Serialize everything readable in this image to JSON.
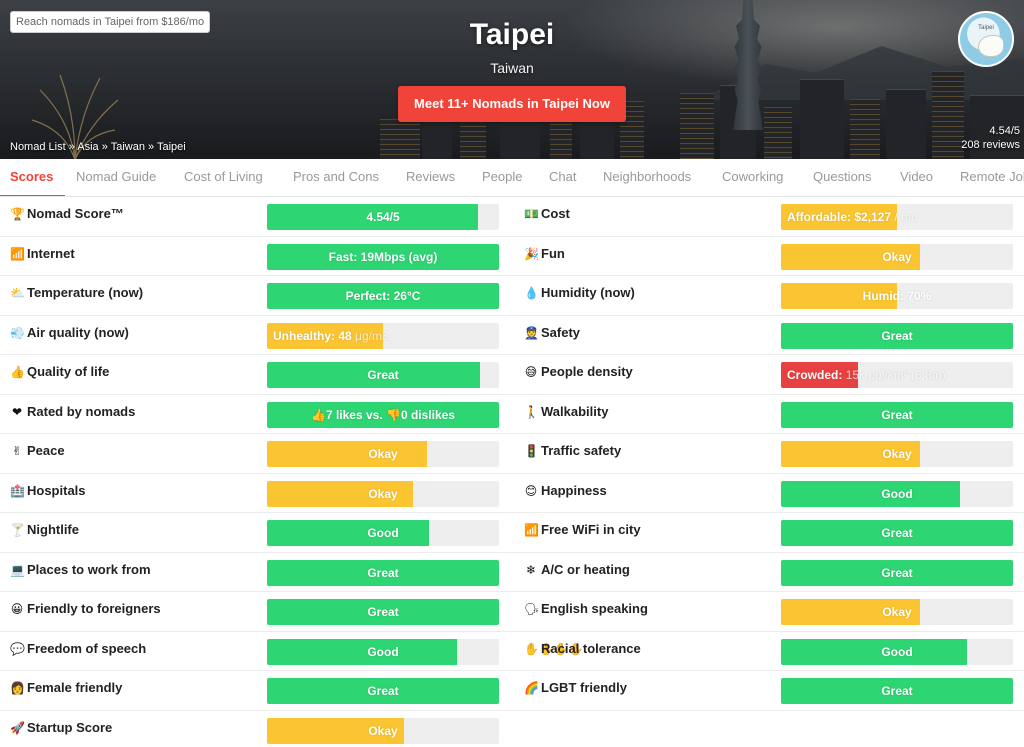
{
  "hero": {
    "promo": "Reach nomads in Taipei from $186/mo",
    "title": "Taipei",
    "country": "Taiwan",
    "cta": "Meet 11+ Nomads in Taipei Now",
    "breadcrumb": [
      "Nomad List",
      "Asia",
      "Taiwan",
      "Taipei"
    ],
    "rating": "4.54/5",
    "reviews": "208 reviews",
    "avatar_text": "Taipei"
  },
  "tabs": [
    "Scores",
    "Nomad Guide",
    "Cost of Living",
    "Pros and Cons",
    "Reviews",
    "People",
    "Chat",
    "Neighborhoods",
    "Coworking",
    "Questions",
    "Video",
    "Remote Jobs"
  ],
  "colors": {
    "accent": "#f0433a",
    "good": "#2ed573",
    "okay": "#fbc531",
    "bad": "#e84141"
  },
  "scores_left": [
    {
      "icon": "trophy-icon",
      "glyph": "🏆",
      "label": "Nomad Score™",
      "value": "4.54/5",
      "level": 0.91,
      "color": "green"
    },
    {
      "icon": "signal-icon",
      "glyph": "📶",
      "label": "Internet",
      "value": "Fast: 19Mbps (avg)",
      "level": 1.0,
      "color": "green"
    },
    {
      "icon": "weather-icon",
      "glyph": "⛅",
      "label": "Temperature (now)",
      "value": "Perfect: 26°C",
      "level": 1.0,
      "color": "green"
    },
    {
      "icon": "wind-icon",
      "glyph": "💨",
      "label": "Air quality (now)",
      "value": "Unhealthy: 48",
      "value_dim": "μg/m3",
      "level": 0.5,
      "color": "yellow"
    },
    {
      "icon": "thumbs-up-icon",
      "glyph": "👍",
      "label": "Quality of life",
      "value": "Great",
      "level": 0.92,
      "color": "green"
    },
    {
      "icon": "heart-icon",
      "glyph": "❤",
      "label": "Rated by nomads",
      "value": "👍7 likes vs. 👎0 dislikes",
      "level": 1.0,
      "color": "green"
    },
    {
      "icon": "peace-icon",
      "glyph": "✌",
      "label": "Peace",
      "value": "Okay",
      "level": 0.69,
      "color": "yellow"
    },
    {
      "icon": "hospital-icon",
      "glyph": "🏥",
      "label": "Hospitals",
      "value": "Okay",
      "level": 0.63,
      "color": "yellow"
    },
    {
      "icon": "cocktail-icon",
      "glyph": "🍸",
      "label": "Nightlife",
      "value": "Good",
      "level": 0.7,
      "color": "green"
    },
    {
      "icon": "laptop-icon",
      "glyph": "💻",
      "label": "Places to work from",
      "value": "Great",
      "level": 1.0,
      "color": "green"
    },
    {
      "icon": "smile-icon",
      "glyph": "😀",
      "label": "Friendly to foreigners",
      "value": "Great",
      "level": 1.0,
      "color": "green"
    },
    {
      "icon": "speech-icon",
      "glyph": "💬",
      "label": "Freedom of speech",
      "value": "Good",
      "level": 0.82,
      "color": "green"
    },
    {
      "icon": "woman-icon",
      "glyph": "👩",
      "label": "Female friendly",
      "value": "Great",
      "level": 1.0,
      "color": "green"
    },
    {
      "icon": "startup-icon",
      "glyph": "🚀",
      "label": "Startup Score",
      "value": "Okay",
      "level": 0.59,
      "color": "yellow"
    }
  ],
  "scores_right": [
    {
      "icon": "money-icon",
      "glyph": "💵",
      "label": "Cost",
      "value": "Affordable: $2,127",
      "value_dim": "/ mo",
      "level": 0.5,
      "color": "yellow"
    },
    {
      "icon": "party-icon",
      "glyph": "🎉",
      "label": "Fun",
      "value": "Okay",
      "level": 0.6,
      "color": "yellow"
    },
    {
      "icon": "droplet-icon",
      "glyph": "💧",
      "label": "Humidity (now)",
      "value": "Humid: 70%",
      "level": 0.5,
      "color": "yellow"
    },
    {
      "icon": "shield-icon",
      "glyph": "👮",
      "label": "Safety",
      "value": "Great",
      "level": 1.0,
      "color": "green"
    },
    {
      "icon": "crowd-icon",
      "glyph": "😅",
      "label": "People density",
      "value": "Crowded:",
      "value_dim": "15k ppl/km² (6.8m)",
      "level": 0.33,
      "color": "red"
    },
    {
      "icon": "walking-icon",
      "glyph": "🚶",
      "label": "Walkability",
      "value": "Great",
      "level": 1.0,
      "color": "green"
    },
    {
      "icon": "traffic-light-icon",
      "glyph": "🚦",
      "label": "Traffic safety",
      "value": "Okay",
      "level": 0.6,
      "color": "yellow"
    },
    {
      "icon": "happy-icon",
      "glyph": "😊",
      "label": "Happiness",
      "value": "Good",
      "level": 0.77,
      "color": "green"
    },
    {
      "icon": "wifi-icon",
      "glyph": "📶",
      "label": "Free WiFi in city",
      "value": "Great",
      "level": 1.0,
      "color": "green"
    },
    {
      "icon": "snowflake-icon",
      "glyph": "❄",
      "label": "A/C or heating",
      "value": "Great",
      "level": 1.0,
      "color": "green"
    },
    {
      "icon": "teacher-icon",
      "glyph": "🗣",
      "label": "English speaking",
      "value": "Okay",
      "level": 0.6,
      "color": "yellow"
    },
    {
      "icon": "hands-icon",
      "glyph": "✋✋✋✋",
      "label": "Racial tolerance",
      "value": "Good",
      "level": 0.8,
      "color": "green"
    },
    {
      "icon": "rainbow-icon",
      "glyph": "🌈",
      "label": "LGBT friendly",
      "value": "Great",
      "level": 1.0,
      "color": "green"
    }
  ]
}
